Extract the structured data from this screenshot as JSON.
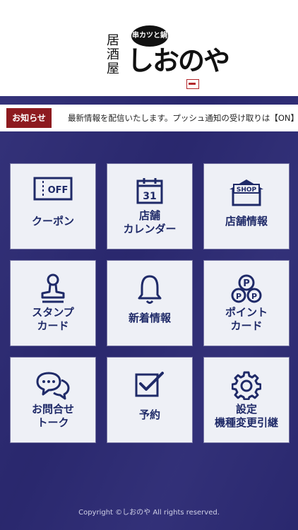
{
  "brand": {
    "vertical_text": [
      "居",
      "酒",
      "屋"
    ],
    "badge_text": "串カツと鍋",
    "name": "しおのや"
  },
  "notice": {
    "label": "お知らせ",
    "text": "最新情報を配信いたします。プッシュ通知の受け取りは【ON】"
  },
  "menu": [
    {
      "label": "クーポン",
      "icon": "coupon-off-icon",
      "icon_text": "OFF"
    },
    {
      "label": "店舗\nカレンダー",
      "icon": "calendar-icon",
      "icon_text": "31"
    },
    {
      "label": "店舗情報",
      "icon": "shop-icon",
      "icon_text": "SHOP"
    },
    {
      "label": "スタンプ\nカード",
      "icon": "stamp-icon"
    },
    {
      "label": "新着情報",
      "icon": "bell-icon"
    },
    {
      "label": "ポイント\nカード",
      "icon": "point-coins-icon",
      "icon_text": "P"
    },
    {
      "label": "お問合せ\nトーク",
      "icon": "chat-bubbles-icon"
    },
    {
      "label": "予約",
      "icon": "checkbox-icon"
    },
    {
      "label": "設定\n機種変更引継",
      "icon": "gear-icon"
    }
  ],
  "footer": {
    "copyright": "Copyright ©しおのや All rights reserved."
  },
  "colors": {
    "background": "#2c2a74",
    "tile": "#eef0f6",
    "icon": "#1f2a68",
    "notice_label": "#8d1a1f"
  }
}
